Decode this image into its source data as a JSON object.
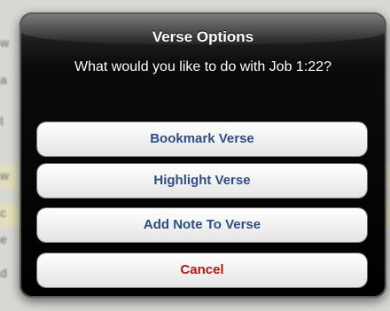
{
  "dialog": {
    "title": "Verse Options",
    "message": "What would you like to do with Job 1:22?"
  },
  "buttons": {
    "bookmark": "Bookmark Verse",
    "highlight": "Highlight Verse",
    "add_note": "Add Note To Verse",
    "cancel": "Cancel"
  },
  "colors": {
    "button_text": "#2d4e85",
    "cancel_text": "#b01a14",
    "dialog_background": "#000000"
  }
}
